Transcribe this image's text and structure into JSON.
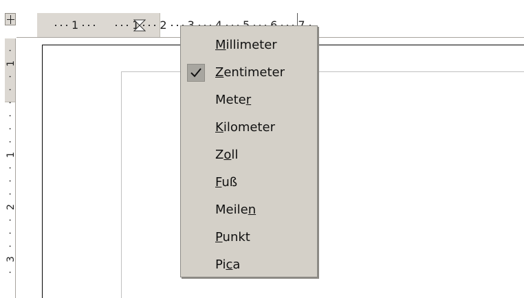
{
  "ruler": {
    "horizontal_numbers": [
      "1",
      "1",
      "2",
      "3",
      "4",
      "5",
      "6",
      "7"
    ],
    "vertical_numbers": [
      "1",
      "1",
      "2",
      "3"
    ]
  },
  "context_menu": {
    "items": [
      {
        "label": "Millimeter",
        "underline_index": 0,
        "checked": false
      },
      {
        "label": "Zentimeter",
        "underline_index": 0,
        "checked": true
      },
      {
        "label": "Meter",
        "underline_index": 4,
        "checked": false
      },
      {
        "label": "Kilometer",
        "underline_index": 0,
        "checked": false
      },
      {
        "label": "Zoll",
        "underline_index": 1,
        "checked": false
      },
      {
        "label": "Fuß",
        "underline_index": 0,
        "checked": false
      },
      {
        "label": "Meilen",
        "underline_index": 5,
        "checked": false
      },
      {
        "label": "Punkt",
        "underline_index": 0,
        "checked": false
      },
      {
        "label": "Pica",
        "underline_index": 2,
        "checked": false
      }
    ]
  },
  "colors": {
    "menu_background": "#d4d0c8",
    "ruler_margin": "#dcd8d2",
    "page_background": "#ffffff"
  }
}
